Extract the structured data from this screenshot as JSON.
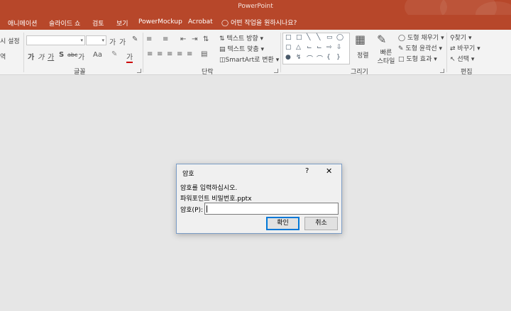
{
  "app": {
    "title": "PowerPoint"
  },
  "tabs": [
    {
      "label": "애니메이션"
    },
    {
      "label": "슬라이드 쇼"
    },
    {
      "label": "검토"
    },
    {
      "label": "보기"
    },
    {
      "label": "PowerMockup"
    },
    {
      "label": "Acrobat"
    }
  ],
  "tell_me": {
    "text": "어떤 작업을 원하시나요?"
  },
  "ribbon": {
    "left_partial": [
      "시 설정",
      "역"
    ],
    "groups": {
      "font": "글꼴",
      "paragraph": "단락",
      "drawing": "그리기",
      "editing": "편집"
    },
    "font_row2": [
      "가",
      "가",
      "가",
      "S",
      "abc",
      "가",
      "Aa"
    ],
    "paragraph": {
      "text_direction": "텍스트 방향",
      "align_text": "텍스트 맞춤",
      "smartart": "SmartArt로 변환"
    },
    "drawing": {
      "arrange": "정렬",
      "quick_styles": "빠른 스타일",
      "shape_fill": "도형 채우기",
      "shape_outline": "도형 윤곽선",
      "shape_effects": "도형 효과"
    },
    "editing": {
      "find": "찾기",
      "replace": "바꾸기",
      "select": "선택"
    }
  },
  "dialog": {
    "title": "암호",
    "help": "?",
    "close": "✕",
    "message": "암호를 입력하십시오.",
    "filename": "파워포인트 비밀번호.pptx",
    "password_label": "암호(P):",
    "password_value": "",
    "ok_label": "확인",
    "cancel_label": "취소"
  }
}
